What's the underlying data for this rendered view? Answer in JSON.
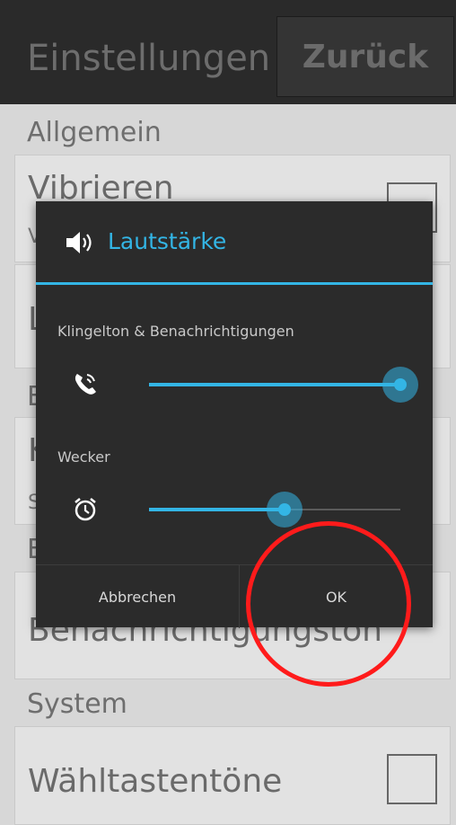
{
  "header": {
    "title": "Einstellungen",
    "back_label": "Zurück"
  },
  "sections": {
    "general_label": "Allgemein",
    "system_label": "System",
    "partial_1": "E",
    "partial_2": "E"
  },
  "items": {
    "vibrate_title": "Vibrieren",
    "vibrate_sub_partial": "V",
    "item2_partial": "L",
    "item3_partial_title": "K",
    "item3_partial_sub": "S",
    "notification_tone": "Benachrichtigungston",
    "dial_tones": "Wähltastentöne"
  },
  "dialog": {
    "title": "Lautstärke",
    "ringtone_label": "Klingelton & Benachrichtigungen",
    "alarm_label": "Wecker",
    "cancel_label": "Abbrechen",
    "ok_label": "OK",
    "ringtone_level": 1.0,
    "alarm_level": 0.54,
    "accent_color": "#33b5e5"
  },
  "annotation": {
    "color": "#ff1b1b"
  }
}
